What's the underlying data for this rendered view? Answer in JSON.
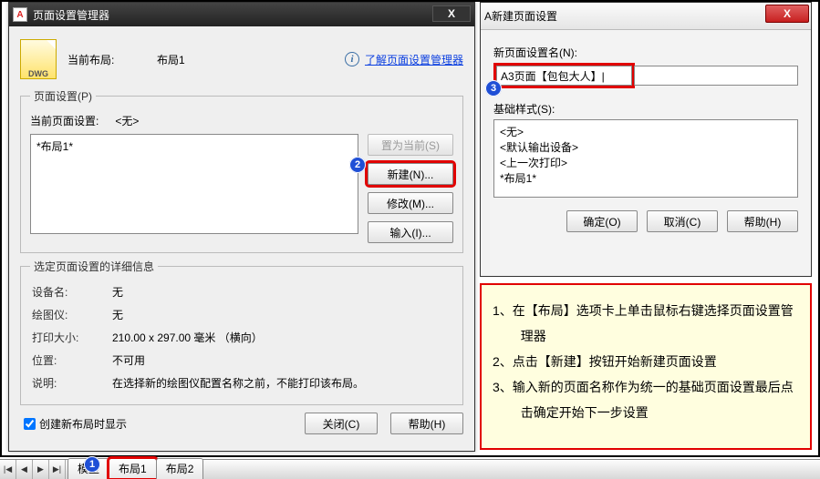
{
  "left_dialog": {
    "title": "页面设置管理器",
    "dwg_label": "DWG",
    "current_layout_label": "当前布局:",
    "current_layout_value": "布局1",
    "learn_link": "了解页面设置管理器",
    "group_title": "页面设置(P)",
    "current_setup_label": "当前页面设置:",
    "current_setup_value": "<无>",
    "list_items": [
      "*布局1*"
    ],
    "btn_setcurrent": "置为当前(S)",
    "btn_new": "新建(N)...",
    "btn_modify": "修改(M)...",
    "btn_import": "输入(I)...",
    "details_title": "选定页面设置的详细信息",
    "details": {
      "device_label": "设备名:",
      "device_value": "无",
      "plotter_label": "绘图仪:",
      "plotter_value": "无",
      "size_label": "打印大小:",
      "size_value": "210.00 x 297.00 毫米 （横向）",
      "location_label": "位置:",
      "location_value": "不可用",
      "desc_label": "说明:",
      "desc_value": "在选择新的绘图仪配置名称之前，不能打印该布局。"
    },
    "checkbox_label": "创建新布局时显示",
    "btn_close": "关闭(C)",
    "btn_help": "帮助(H)"
  },
  "right_dialog": {
    "title": "新建页面设置",
    "name_label": "新页面设置名(N):",
    "name_value": "A3页面【包包大人】|",
    "base_label": "基础样式(S):",
    "base_items": [
      "<无>",
      "<默认输出设备>",
      "<上一次打印>",
      "*布局1*"
    ],
    "btn_ok": "确定(O)",
    "btn_cancel": "取消(C)",
    "btn_help": "帮助(H)"
  },
  "instructions": {
    "line1": "1、在【布局】选项卡上单击鼠标右键选择页面设置管理器",
    "line2": "2、点击【新建】按钮开始新建页面设置",
    "line3": "3、输入新的页面名称作为统一的基础页面设置最后点击确定开始下一步设置"
  },
  "tabs": {
    "model": "模型",
    "layout1": "布局1",
    "layout2": "布局2"
  },
  "markers": {
    "m1": "1",
    "m2": "2",
    "m3": "3"
  },
  "glyphs": {
    "close_x": "X",
    "info": "i",
    "app": "A",
    "nav_first": "|◀",
    "nav_prev": "◀",
    "nav_next": "▶",
    "nav_last": "▶|"
  }
}
